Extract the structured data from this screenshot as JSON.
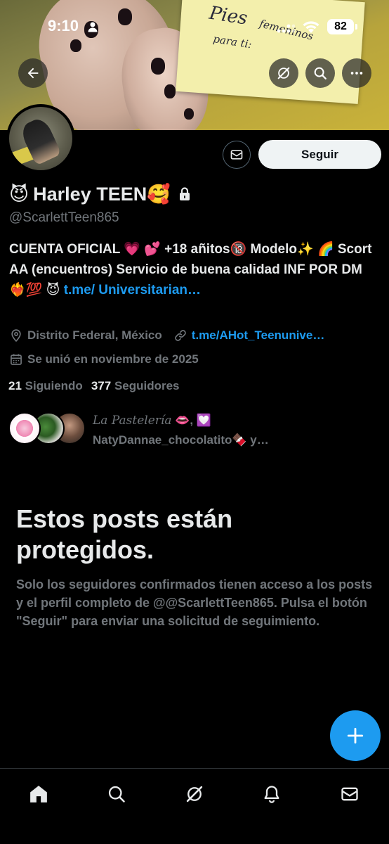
{
  "status_bar": {
    "time": "9:10",
    "battery": "82"
  },
  "banner": {
    "note_line1": "Pies",
    "note_line2": "femeninos",
    "note_line3": "para ti:"
  },
  "icons": {
    "back": "arrow-left-icon",
    "grok": "grok-icon",
    "search": "search-icon",
    "more": "more-icon",
    "message": "envelope-icon",
    "lock": "lock-icon",
    "location": "location-pin-icon",
    "link": "link-icon",
    "calendar": "calendar-icon",
    "compose": "plus-icon",
    "nav_home": "home-icon",
    "nav_search": "search-icon",
    "nav_grok": "grok-icon",
    "nav_notifications": "bell-icon",
    "nav_messages": "envelope-icon"
  },
  "colors": {
    "accent": "#1d9bf0",
    "background": "#000000",
    "text_primary": "#e7e9ea",
    "text_secondary": "#71767b"
  },
  "profile": {
    "follow_label": "Seguir",
    "display_name_emoji_lead": "😈",
    "display_name": "Harley TEEN",
    "display_name_emoji_trail": "🥰",
    "handle": "@ScarlettTeen865",
    "bio_text": "CUENTA OFICIAL 💗 💕 +18 añitos🔞 Modelo✨ 🌈 Scort AA (encuentros) Servicio de buena calidad INF POR DM ❤️‍🔥💯 😈",
    "bio_link": "t.me/ Universitarian…",
    "location": "Distrito Federal, México",
    "website": "t.me/AHot_Teenunive…",
    "joined": "Se unió en noviembre de 2025",
    "following_count": "21",
    "following_label": "Siguiendo",
    "followers_count": "377",
    "followers_label": "Seguidores",
    "followed_by_name1": "La Pastelería",
    "followed_by_emoji1": "👄",
    "followed_by_sep": ",",
    "followed_by_emoji2": "💟",
    "followed_by_line2": "NatyDannae_chocolatito🍫 y…"
  },
  "protected": {
    "title": "Estos posts están protegidos.",
    "description": "Solo los seguidores confirmados tienen acceso a los posts y el perfil completo de @@ScarlettTeen865. Pulsa el botón \"Seguir\" para enviar una solicitud de seguimiento."
  }
}
